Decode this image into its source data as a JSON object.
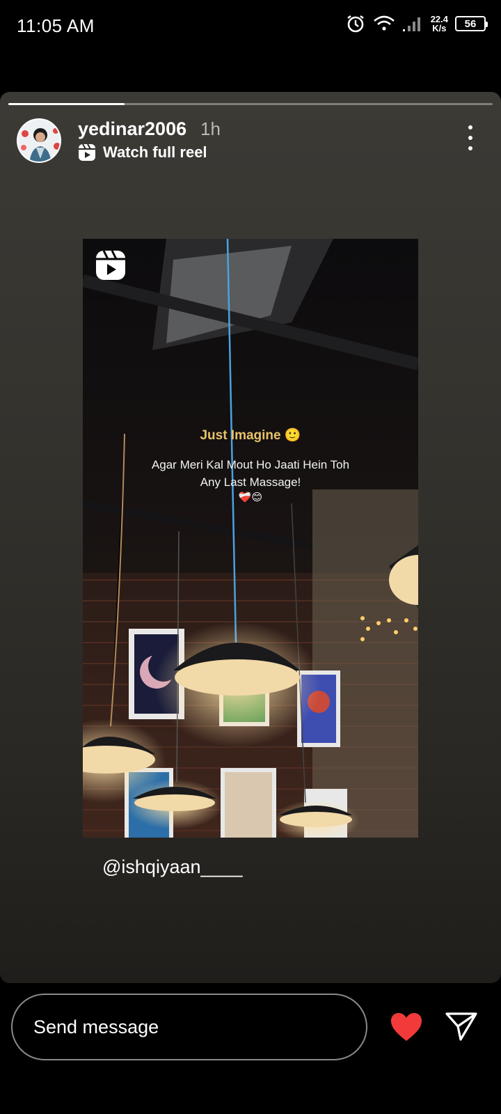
{
  "status_bar": {
    "time": "11:05 AM",
    "speed_value": "22.4",
    "speed_unit": "K/s",
    "battery": "56"
  },
  "story": {
    "progress": 0.24,
    "username": "yedinar2006",
    "time_ago": "1h",
    "reel_label": "Watch full reel",
    "reel": {
      "caption_title": "Just Imagine 🙂",
      "caption_line1": "Agar Meri Kal Mout Ho Jaati Hein Toh",
      "caption_line2": "Any Last Massage!",
      "caption_emoji": "❤️‍🩹😊"
    },
    "mention": "@ishqiyaan____"
  },
  "bottom_bar": {
    "message_placeholder": "Send message"
  },
  "colors": {
    "accent_heart": "#f23a3a",
    "caption_title": "#e8c36a"
  }
}
